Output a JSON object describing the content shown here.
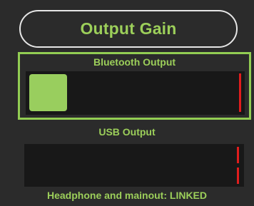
{
  "title": "Output Gain",
  "bluetooth": {
    "label": "Bluetooth Output",
    "level": 0.0
  },
  "usb": {
    "label": "USB Output"
  },
  "status": "Headphone and mainout: LINKED",
  "colors": {
    "accent": "#9ccf5a",
    "highlight_border": "#92cd53",
    "meter_red": "#e01d1d",
    "background": "#2b2b2b",
    "track": "#181818"
  }
}
